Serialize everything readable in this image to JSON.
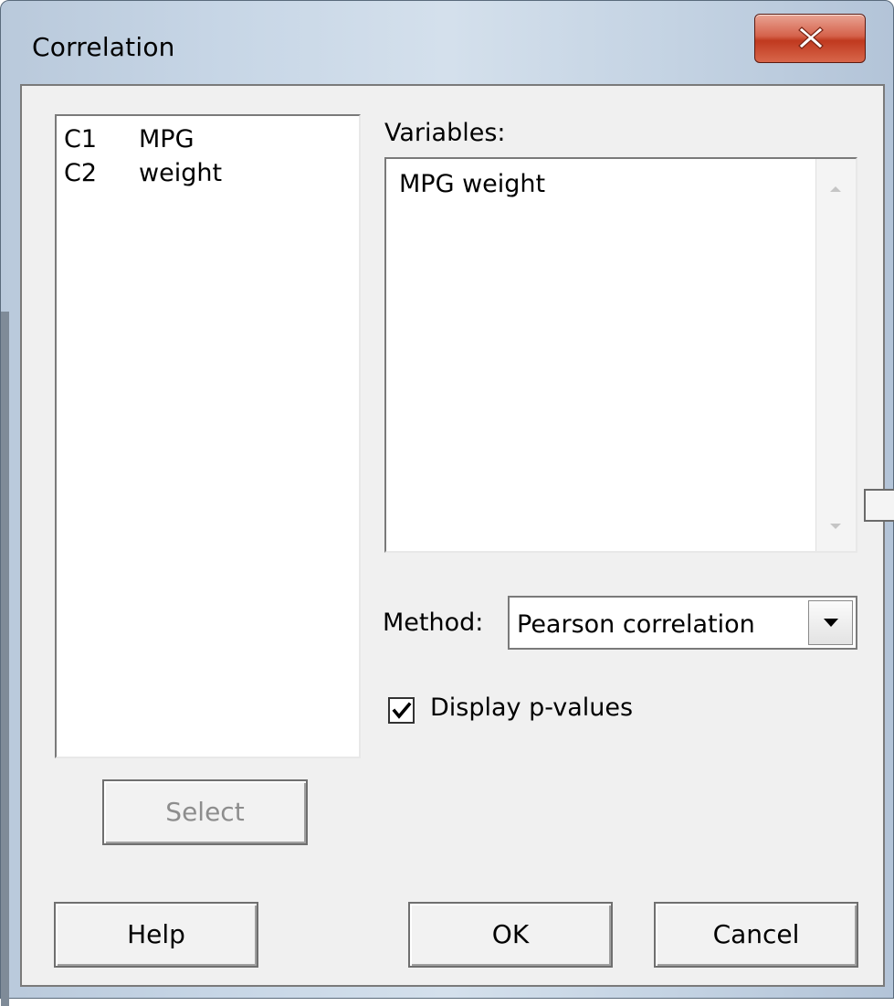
{
  "window": {
    "title": "Correlation",
    "close_icon": "close-icon"
  },
  "columns_list": {
    "items": [
      {
        "id": "C1",
        "name": "MPG"
      },
      {
        "id": "C2",
        "name": "weight"
      }
    ]
  },
  "variables": {
    "label": "Variables:",
    "value": "MPG weight"
  },
  "method": {
    "label": "Method:",
    "selected": "Pearson correlation"
  },
  "display_pvalues": {
    "label": "Display p-values",
    "checked": true
  },
  "buttons": {
    "select": "Select",
    "help": "Help",
    "ok": "OK",
    "cancel": "Cancel"
  },
  "colors": {
    "close_button": "#c7432b",
    "dialog_background": "#f0f0f0",
    "disabled_text": "#8d8d8d"
  }
}
